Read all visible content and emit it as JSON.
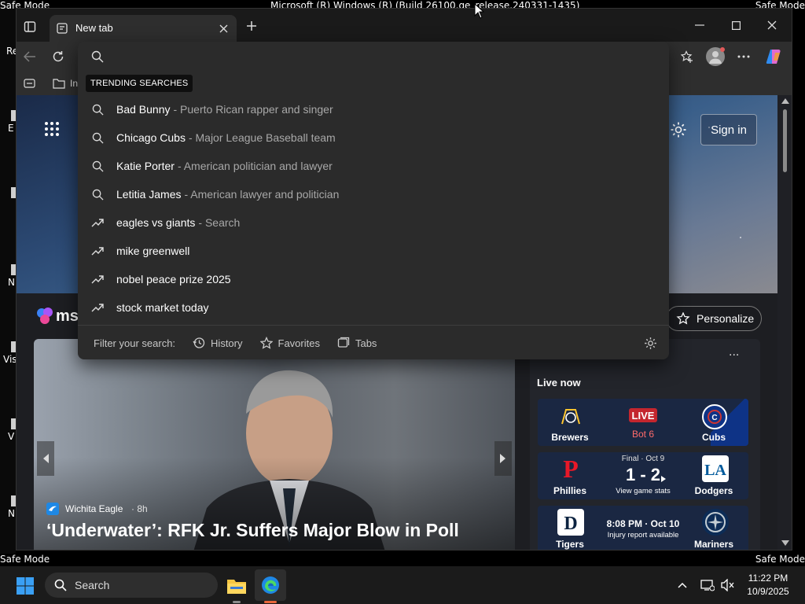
{
  "system": {
    "safe_mode_label": "Safe Mode",
    "build_title": "Microsoft (R) Windows (R) (Build 26100.ge_release.240331-1435)",
    "desktop_fragments": [
      "Re",
      "E",
      "N",
      "Vis",
      "V",
      "N"
    ]
  },
  "browser": {
    "tab_title": "New tab",
    "omnibox_value": "",
    "favbar_fragment": "In",
    "trending_label": "TRENDING SEARCHES",
    "suggestions": [
      {
        "main": "Bad Bunny",
        "desc": "- Puerto Rican rapper and singer",
        "icon": "search-icon"
      },
      {
        "main": "Chicago Cubs",
        "desc": "- Major League Baseball team",
        "icon": "search-icon"
      },
      {
        "main": "Katie Porter",
        "desc": "- American politician and lawyer",
        "icon": "search-icon"
      },
      {
        "main": "Letitia James",
        "desc": "- American lawyer and politician",
        "icon": "search-icon"
      },
      {
        "main": "eagles vs giants",
        "desc": "- Search",
        "icon": "trending-icon"
      },
      {
        "main": "mike greenwell",
        "desc": "",
        "icon": "trending-icon"
      },
      {
        "main": "nobel peace prize 2025",
        "desc": "",
        "icon": "trending-icon"
      },
      {
        "main": "stock market today",
        "desc": "",
        "icon": "trending-icon"
      }
    ],
    "filter": {
      "label": "Filter your search:",
      "history": "History",
      "favorites": "Favorites",
      "tabs": "Tabs"
    }
  },
  "newtab": {
    "sign_in": "Sign in",
    "logo_fragment": "ms",
    "personalize": "Personalize",
    "headline": {
      "source": "Wichita Eagle",
      "age": "· 8h",
      "title": "‘Underwater’: RFK Jr. Suffers Major Blow in Poll"
    },
    "live_now": "Live now",
    "more": "...",
    "games": [
      {
        "home": "Brewers",
        "away": "Cubs",
        "status_badge": "LIVE",
        "status_detail": "Bot 6",
        "score": "",
        "subtext": ""
      },
      {
        "home": "Phillies",
        "away": "Dodgers",
        "status_badge": "",
        "status_detail": "Final · Oct 9",
        "score": "1 - 2",
        "subtext": "View game stats"
      },
      {
        "home": "Tigers",
        "away": "Mariners",
        "status_badge": "",
        "status_detail": "8:08 PM · Oct 10",
        "score": "",
        "subtext": "Injury report available"
      }
    ]
  },
  "taskbar": {
    "search_placeholder": "Search",
    "time": "11:22 PM",
    "date": "10/9/2025"
  },
  "colors": {
    "live_red": "#c4262e",
    "phillies_red": "#e81828",
    "dodgers_blue": "#005a9c",
    "mariners_navy": "#0c2c56",
    "cubs_blue": "#0e3386"
  }
}
